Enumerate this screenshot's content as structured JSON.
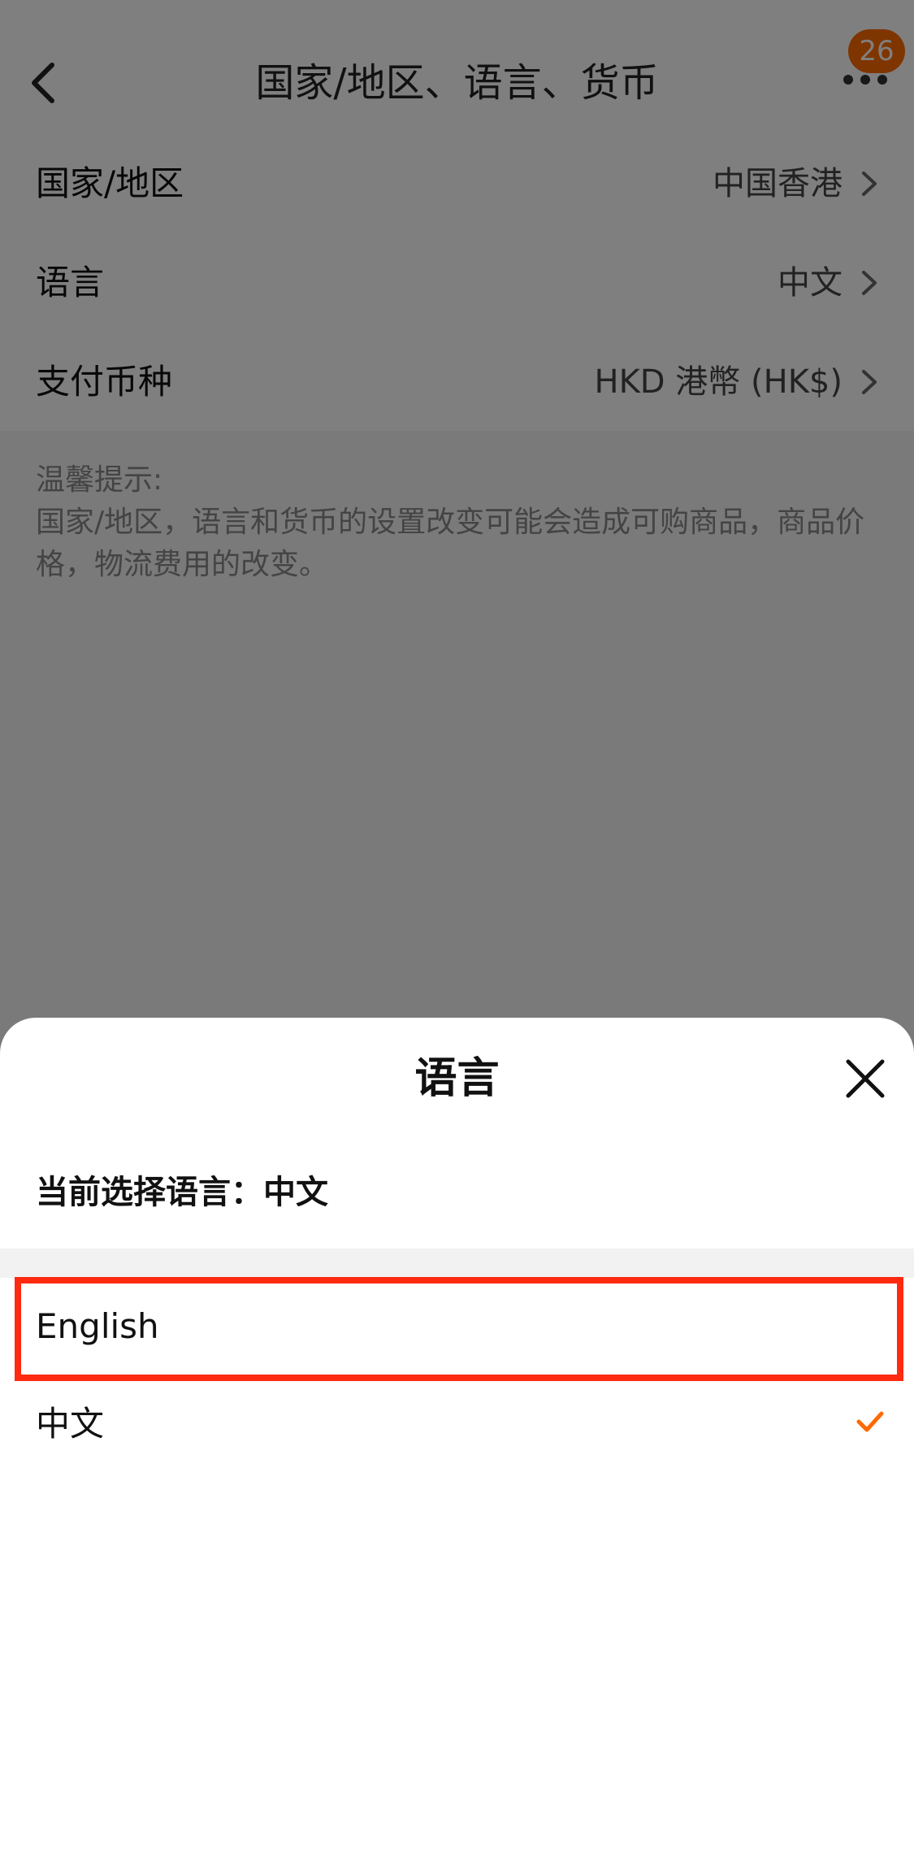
{
  "header": {
    "title": "国家/地区、语言、货币",
    "badge_count": "26"
  },
  "settings": [
    {
      "label": "国家/地区",
      "value": "中国香港"
    },
    {
      "label": "语言",
      "value": "中文"
    },
    {
      "label": "支付币种",
      "value": "HKD 港幣 (HK$)"
    }
  ],
  "tips": {
    "heading": "温馨提示:",
    "text": "国家/地区，语言和货币的设置改变可能会造成可购商品，商品价格，物流费用的改变。"
  },
  "sheet": {
    "title": "语言",
    "current_label": "当前选择语言：",
    "current_value": "中文",
    "options": [
      {
        "label": "English",
        "selected": false
      },
      {
        "label": "中文",
        "selected": true
      }
    ]
  },
  "colors": {
    "accent": "#ff6a00",
    "highlight": "#ff2a10",
    "overlay": "rgba(0,0,0,0.5)"
  },
  "icons": {
    "back": "chevron-left-icon",
    "more": "more-dots-icon",
    "row": "chevron-right-icon",
    "close": "close-icon",
    "check": "check-icon"
  }
}
